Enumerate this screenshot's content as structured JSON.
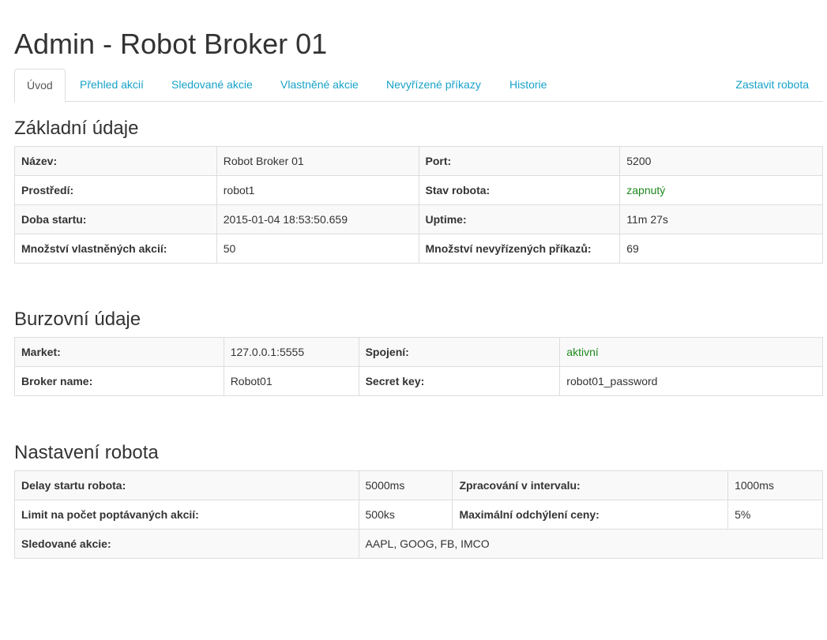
{
  "header": {
    "title": "Admin - Robot Broker 01"
  },
  "tabs": {
    "uvod": "Úvod",
    "prehled": "Přehled akcií",
    "sledovane": "Sledované akcie",
    "vlastnene": "Vlastněné akcie",
    "nevyrizene": "Nevyřízené příkazy",
    "historie": "Historie",
    "zastavit": "Zastavit robota"
  },
  "zakladni": {
    "heading": "Základní údaje",
    "nazev_label": "Název:",
    "nazev_value": "Robot Broker 01",
    "port_label": "Port:",
    "port_value": "5200",
    "prostredi_label": "Prostředí:",
    "prostredi_value": "robot1",
    "stav_label": "Stav robota:",
    "stav_value": "zapnutý",
    "doba_label": "Doba startu:",
    "doba_value": "2015-01-04 18:53:50.659",
    "uptime_label": "Uptime:",
    "uptime_value": "11m 27s",
    "vlastnenych_label": "Množství vlastněných akcií:",
    "vlastnenych_value": "50",
    "nevyrizenych_label": "Množství nevyřízených příkazů:",
    "nevyrizenych_value": "69"
  },
  "burzovni": {
    "heading": "Burzovní údaje",
    "market_label": "Market:",
    "market_value": "127.0.0.1:5555",
    "spojeni_label": "Spojení:",
    "spojeni_value": "aktivní",
    "broker_label": "Broker name:",
    "broker_value": "Robot01",
    "secret_label": "Secret key:",
    "secret_value": "robot01_password"
  },
  "nastaveni": {
    "heading": "Nastavení robota",
    "delay_label": "Delay startu robota:",
    "delay_value": "5000ms",
    "interval_label": "Zpracování v intervalu:",
    "interval_value": "1000ms",
    "limit_label": "Limit na počet poptávaných akcií:",
    "limit_value": "500ks",
    "odchyleni_label": "Maximální odchýlení ceny:",
    "odchyleni_value": "5%",
    "sledovane_label": "Sledované akcie:",
    "sledovane_value": "AAPL, GOOG, FB, IMCO"
  },
  "colors": {
    "link": "#17a2c8",
    "status_ok": "#1e8a1e",
    "border": "#dddddd",
    "stripe": "#f9f9f9"
  }
}
